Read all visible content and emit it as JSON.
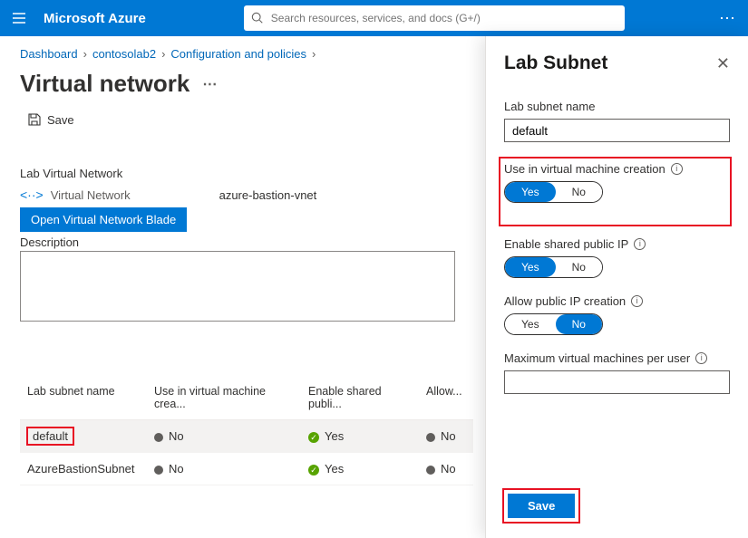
{
  "topbar": {
    "brand": "Microsoft Azure",
    "search_placeholder": "Search resources, services, and docs (G+/)"
  },
  "breadcrumb": {
    "items": [
      "Dashboard",
      "contosolab2",
      "Configuration and policies"
    ]
  },
  "page": {
    "title": "Virtual network",
    "toolbar_save": "Save",
    "section_label": "Lab Virtual Network",
    "vn_label": "Virtual Network",
    "vn_value": "azure-bastion-vnet",
    "open_blade_btn": "Open Virtual Network Blade",
    "description_label": "Description"
  },
  "table": {
    "headers": {
      "c1": "Lab subnet name",
      "c2": "Use in virtual machine crea...",
      "c3": "Enable shared publi...",
      "c4": "Allow..."
    },
    "rows": [
      {
        "name": "default",
        "use": "No",
        "shared": "Yes",
        "allow": "No",
        "highlight": true,
        "redbox": true
      },
      {
        "name": "AzureBastionSubnet",
        "use": "No",
        "shared": "Yes",
        "allow": "No",
        "highlight": false,
        "redbox": false
      }
    ]
  },
  "panel": {
    "title": "Lab Subnet",
    "subnet_name_label": "Lab subnet name",
    "subnet_name_value": "default",
    "use_vm_label": "Use in virtual machine creation",
    "enable_shared_label": "Enable shared public IP",
    "allow_public_label": "Allow public IP creation",
    "max_vm_label": "Maximum virtual machines per user",
    "yes": "Yes",
    "no": "No",
    "save": "Save",
    "toggles": {
      "use_vm": "Yes",
      "enable_shared": "Yes",
      "allow_public": "No"
    }
  }
}
